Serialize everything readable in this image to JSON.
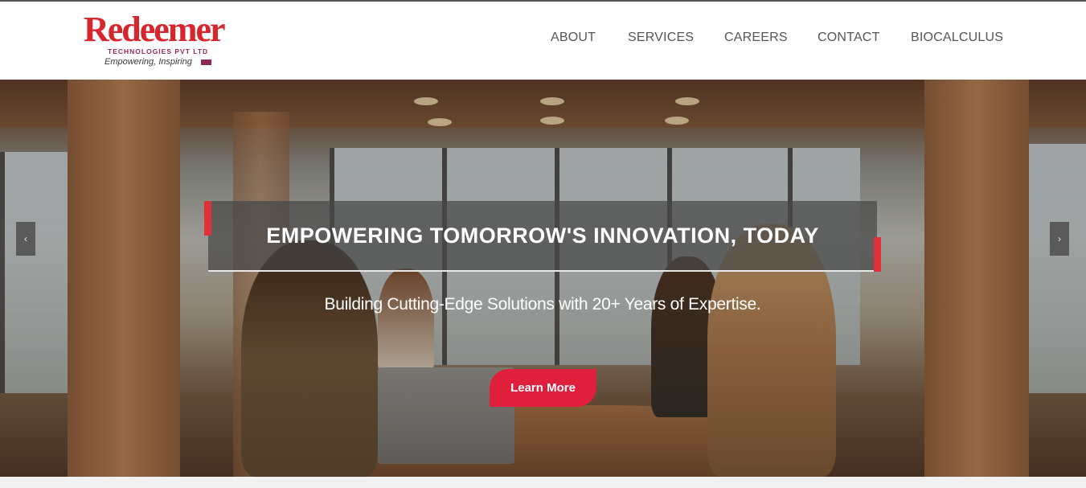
{
  "brand": {
    "name": "Redeemer",
    "subtitle": "TECHNOLOGIES PVT LTD",
    "tagline": "Empowering, Inspiring"
  },
  "nav": {
    "items": [
      {
        "label": "ABOUT"
      },
      {
        "label": "SERVICES"
      },
      {
        "label": "CAREERS"
      },
      {
        "label": "CONTACT"
      },
      {
        "label": "BIOCALCULUS"
      }
    ]
  },
  "hero": {
    "headline": "EMPOWERING TOMORROW'S INNOVATION, TODAY",
    "subtitle": "Building Cutting-Edge Solutions with 20+ Years of Expertise.",
    "cta_label": "Learn More",
    "prev_label": "‹",
    "next_label": "›"
  },
  "colors": {
    "accent": "#e01f3d",
    "brand_red": "#d7262e",
    "nav_text": "#555555"
  }
}
